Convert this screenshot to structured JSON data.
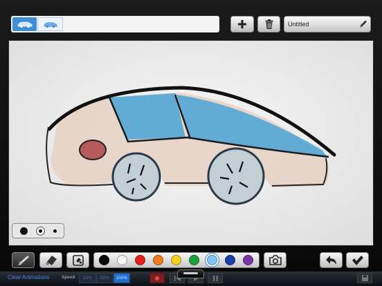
{
  "document": {
    "title": "Untitled"
  },
  "frames": [
    {
      "selected": true
    },
    {
      "selected": false
    }
  ],
  "toolbar_top": {
    "add_icon": "plus-icon",
    "delete_icon": "trash-icon",
    "rename_icon": "pencil-icon"
  },
  "brush_sizes": [
    "large",
    "medium",
    "small"
  ],
  "selected_brush_size": "medium",
  "tools": {
    "brush_icon": "paintbrush-icon",
    "eraser_icon": "eraser-icon",
    "fill_icon": "fill-icon",
    "camera_icon": "camera-icon",
    "undo_icon": "undo-arrow-icon",
    "done_icon": "checkmark-icon"
  },
  "palette": {
    "colors": [
      "#0a0a0a",
      "#f5f5f5",
      "#e3211b",
      "#ef7b1a",
      "#f4cf1c",
      "#1f9f3c",
      "#7fc8f5",
      "#1f3fa8",
      "#7a35a6"
    ],
    "selected_index": 6
  },
  "status_bar": {
    "clear_animations_label": "Clear Animations",
    "speed_label": "Speed",
    "speed_options": [
      "25%",
      "50%",
      "100%"
    ],
    "selected_speed": "100%"
  }
}
